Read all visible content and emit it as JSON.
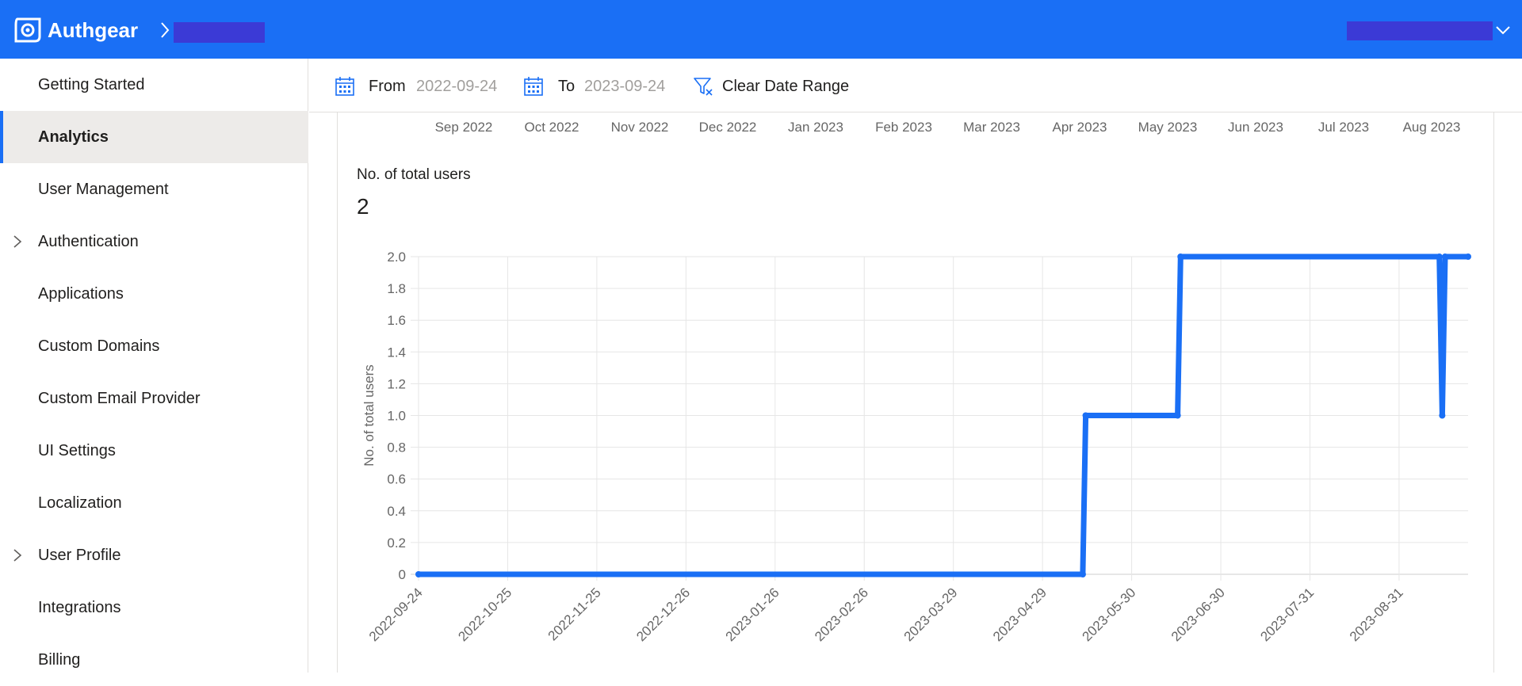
{
  "header": {
    "brand": "Authgear",
    "logo_icon": "authgear-logo-icon",
    "background_color": "#1a6ff5"
  },
  "sidebar": {
    "items": [
      {
        "label": "Getting Started",
        "active": false,
        "expandable": false
      },
      {
        "label": "Analytics",
        "active": true,
        "expandable": false
      },
      {
        "label": "User Management",
        "active": false,
        "expandable": false
      },
      {
        "label": "Authentication",
        "active": false,
        "expandable": true
      },
      {
        "label": "Applications",
        "active": false,
        "expandable": false
      },
      {
        "label": "Custom Domains",
        "active": false,
        "expandable": false
      },
      {
        "label": "Custom Email Provider",
        "active": false,
        "expandable": false
      },
      {
        "label": "UI Settings",
        "active": false,
        "expandable": false
      },
      {
        "label": "Localization",
        "active": false,
        "expandable": false
      },
      {
        "label": "User Profile",
        "active": false,
        "expandable": true
      },
      {
        "label": "Integrations",
        "active": false,
        "expandable": false
      },
      {
        "label": "Billing",
        "active": false,
        "expandable": false
      }
    ]
  },
  "toolbar": {
    "from_label": "From",
    "from_value": "2022-09-24",
    "to_label": "To",
    "to_value": "2023-09-24",
    "clear_label": "Clear Date Range"
  },
  "month_axis": {
    "labels": [
      "Sep 2022",
      "Oct 2022",
      "Nov 2022",
      "Dec 2022",
      "Jan 2023",
      "Feb 2023",
      "Mar 2023",
      "Apr 2023",
      "May 2023",
      "Jun 2023",
      "Jul 2023",
      "Aug 2023"
    ]
  },
  "card": {
    "title": "No. of total users",
    "value": "2"
  },
  "chart_data": {
    "type": "line",
    "title": "",
    "xlabel": "",
    "ylabel": "No. of total users",
    "ylim": [
      0,
      2
    ],
    "y_ticks": [
      "0",
      "0.2",
      "0.4",
      "0.6",
      "0.8",
      "1.0",
      "1.2",
      "1.4",
      "1.6",
      "1.8",
      "2.0"
    ],
    "x_ticks": [
      "2022-09-24",
      "2022-10-25",
      "2022-11-25",
      "2022-12-26",
      "2023-01-26",
      "2023-02-26",
      "2023-03-29",
      "2023-04-29",
      "2023-05-30",
      "2023-06-30",
      "2023-07-31",
      "2023-08-31"
    ],
    "xlim": [
      "2022-09-24",
      "2023-09-24"
    ],
    "grid": true,
    "line_color": "#1a6ff5",
    "series": [
      {
        "points": [
          [
            "2022-09-24",
            0
          ],
          [
            "2023-05-13",
            0
          ],
          [
            "2023-05-14",
            1
          ],
          [
            "2023-06-15",
            1
          ],
          [
            "2023-06-16",
            2
          ],
          [
            "2023-09-14",
            2
          ],
          [
            "2023-09-15",
            1
          ],
          [
            "2023-09-16",
            2
          ],
          [
            "2023-09-24",
            2
          ]
        ]
      }
    ]
  }
}
